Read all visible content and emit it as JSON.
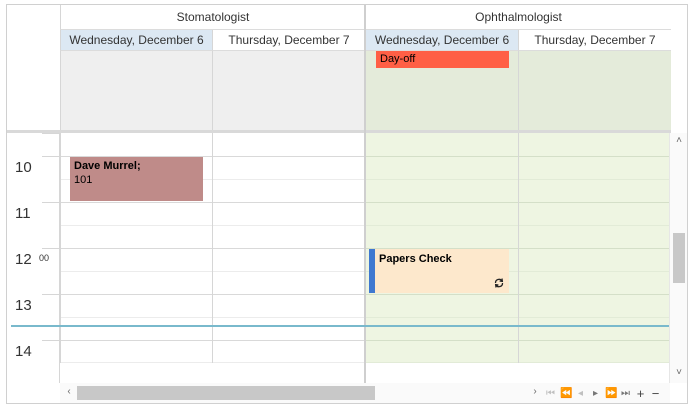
{
  "resources": [
    "Stomatologist",
    "Ophthalmologist"
  ],
  "dates": [
    "Wednesday, December 6",
    "Thursday, December 7"
  ],
  "hours": [
    {
      "hour": "10",
      "minutes": ""
    },
    {
      "hour": "11",
      "minutes": ""
    },
    {
      "hour": "12",
      "minutes": "00"
    },
    {
      "hour": "13",
      "minutes": ""
    },
    {
      "hour": "14",
      "minutes": ""
    }
  ],
  "allday_event": {
    "label": "Day-off",
    "color": "#ff5f45"
  },
  "appointments": [
    {
      "title": "Dave Murrel;",
      "subtitle": "101",
      "color": "#bf8b89"
    },
    {
      "title": "Papers Check",
      "color": "#fde8cc",
      "accent": "#3f78d0",
      "recurring_icon": "recurrence-icon"
    }
  ],
  "colors": {
    "selected_date_header": "#dce8f3",
    "working_area": "#eef5e2",
    "time_indicator": "#79b9cc"
  },
  "navigation": {
    "icons": [
      "first-page-icon",
      "previous-page-icon",
      "previous-icon",
      "next-icon",
      "next-page-icon",
      "last-page-icon",
      "add-icon",
      "remove-icon"
    ]
  }
}
